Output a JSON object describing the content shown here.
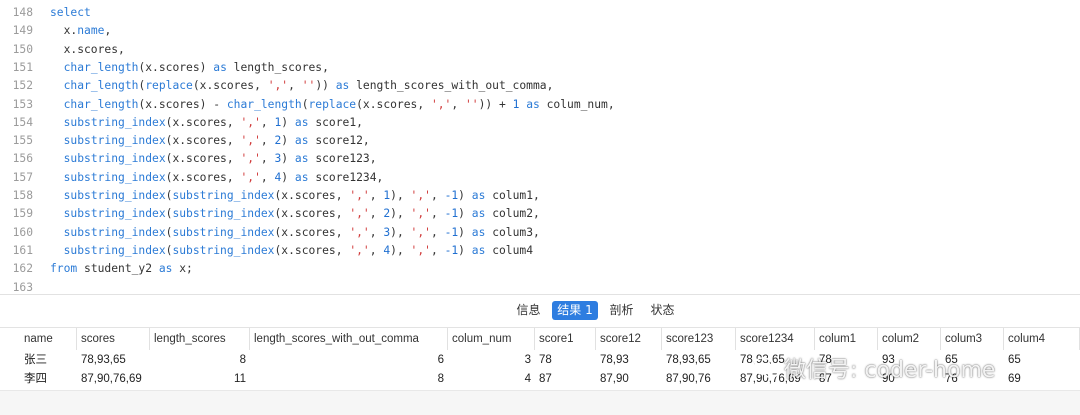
{
  "editor": {
    "lines": [
      {
        "num": "148",
        "tokens": [
          [
            "kw",
            "select"
          ]
        ]
      },
      {
        "num": "149",
        "tokens": [
          [
            "id",
            "  x."
          ],
          [
            "kw",
            "name"
          ],
          [
            "id",
            ","
          ]
        ]
      },
      {
        "num": "150",
        "tokens": [
          [
            "id",
            "  x.scores,"
          ]
        ]
      },
      {
        "num": "151",
        "tokens": [
          [
            "id",
            "  "
          ],
          [
            "fn",
            "char_length"
          ],
          [
            "id",
            "(x.scores) "
          ],
          [
            "kw",
            "as"
          ],
          [
            "id",
            " length_scores,"
          ]
        ]
      },
      {
        "num": "152",
        "tokens": [
          [
            "id",
            "  "
          ],
          [
            "fn",
            "char_length"
          ],
          [
            "id",
            "("
          ],
          [
            "fn",
            "replace"
          ],
          [
            "id",
            "(x.scores, "
          ],
          [
            "str",
            "','"
          ],
          [
            "id",
            ", "
          ],
          [
            "str",
            "''"
          ],
          [
            "id",
            ")) "
          ],
          [
            "kw",
            "as"
          ],
          [
            "id",
            " length_scores_with_out_comma,"
          ]
        ]
      },
      {
        "num": "153",
        "tokens": [
          [
            "id",
            "  "
          ],
          [
            "fn",
            "char_length"
          ],
          [
            "id",
            "(x.scores) - "
          ],
          [
            "fn",
            "char_length"
          ],
          [
            "id",
            "("
          ],
          [
            "fn",
            "replace"
          ],
          [
            "id",
            "(x.scores, "
          ],
          [
            "str",
            "','"
          ],
          [
            "id",
            ", "
          ],
          [
            "str",
            "''"
          ],
          [
            "id",
            ")) + "
          ],
          [
            "num",
            "1"
          ],
          [
            "id",
            " "
          ],
          [
            "kw",
            "as"
          ],
          [
            "id",
            " colum_num,"
          ]
        ]
      },
      {
        "num": "154",
        "tokens": [
          [
            "id",
            "  "
          ],
          [
            "fn",
            "substring_index"
          ],
          [
            "id",
            "(x.scores, "
          ],
          [
            "str",
            "','"
          ],
          [
            "id",
            ", "
          ],
          [
            "num",
            "1"
          ],
          [
            "id",
            ") "
          ],
          [
            "kw",
            "as"
          ],
          [
            "id",
            " score1,"
          ]
        ]
      },
      {
        "num": "155",
        "tokens": [
          [
            "id",
            "  "
          ],
          [
            "fn",
            "substring_index"
          ],
          [
            "id",
            "(x.scores, "
          ],
          [
            "str",
            "','"
          ],
          [
            "id",
            ", "
          ],
          [
            "num",
            "2"
          ],
          [
            "id",
            ") "
          ],
          [
            "kw",
            "as"
          ],
          [
            "id",
            " score12,"
          ]
        ]
      },
      {
        "num": "156",
        "tokens": [
          [
            "id",
            "  "
          ],
          [
            "fn",
            "substring_index"
          ],
          [
            "id",
            "(x.scores, "
          ],
          [
            "str",
            "','"
          ],
          [
            "id",
            ", "
          ],
          [
            "num",
            "3"
          ],
          [
            "id",
            ") "
          ],
          [
            "kw",
            "as"
          ],
          [
            "id",
            " score123,"
          ]
        ]
      },
      {
        "num": "157",
        "tokens": [
          [
            "id",
            "  "
          ],
          [
            "fn",
            "substring_index"
          ],
          [
            "id",
            "(x.scores, "
          ],
          [
            "str",
            "','"
          ],
          [
            "id",
            ", "
          ],
          [
            "num",
            "4"
          ],
          [
            "id",
            ") "
          ],
          [
            "kw",
            "as"
          ],
          [
            "id",
            " score1234,"
          ]
        ]
      },
      {
        "num": "158",
        "tokens": [
          [
            "id",
            "  "
          ],
          [
            "fn",
            "substring_index"
          ],
          [
            "id",
            "("
          ],
          [
            "fn",
            "substring_index"
          ],
          [
            "id",
            "(x.scores, "
          ],
          [
            "str",
            "','"
          ],
          [
            "id",
            ", "
          ],
          [
            "num",
            "1"
          ],
          [
            "id",
            "), "
          ],
          [
            "str",
            "','"
          ],
          [
            "id",
            ", "
          ],
          [
            "num",
            "-1"
          ],
          [
            "id",
            ") "
          ],
          [
            "kw",
            "as"
          ],
          [
            "id",
            " colum1,"
          ]
        ]
      },
      {
        "num": "159",
        "tokens": [
          [
            "id",
            "  "
          ],
          [
            "fn",
            "substring_index"
          ],
          [
            "id",
            "("
          ],
          [
            "fn",
            "substring_index"
          ],
          [
            "id",
            "(x.scores, "
          ],
          [
            "str",
            "','"
          ],
          [
            "id",
            ", "
          ],
          [
            "num",
            "2"
          ],
          [
            "id",
            "), "
          ],
          [
            "str",
            "','"
          ],
          [
            "id",
            ", "
          ],
          [
            "num",
            "-1"
          ],
          [
            "id",
            ") "
          ],
          [
            "kw",
            "as"
          ],
          [
            "id",
            " colum2,"
          ]
        ]
      },
      {
        "num": "160",
        "tokens": [
          [
            "id",
            "  "
          ],
          [
            "fn",
            "substring_index"
          ],
          [
            "id",
            "("
          ],
          [
            "fn",
            "substring_index"
          ],
          [
            "id",
            "(x.scores, "
          ],
          [
            "str",
            "','"
          ],
          [
            "id",
            ", "
          ],
          [
            "num",
            "3"
          ],
          [
            "id",
            "), "
          ],
          [
            "str",
            "','"
          ],
          [
            "id",
            ", "
          ],
          [
            "num",
            "-1"
          ],
          [
            "id",
            ") "
          ],
          [
            "kw",
            "as"
          ],
          [
            "id",
            " colum3,"
          ]
        ]
      },
      {
        "num": "161",
        "tokens": [
          [
            "id",
            "  "
          ],
          [
            "fn",
            "substring_index"
          ],
          [
            "id",
            "("
          ],
          [
            "fn",
            "substring_index"
          ],
          [
            "id",
            "(x.scores, "
          ],
          [
            "str",
            "','"
          ],
          [
            "id",
            ", "
          ],
          [
            "num",
            "4"
          ],
          [
            "id",
            "), "
          ],
          [
            "str",
            "','"
          ],
          [
            "id",
            ", "
          ],
          [
            "num",
            "-1"
          ],
          [
            "id",
            ") "
          ],
          [
            "kw",
            "as"
          ],
          [
            "id",
            " colum4"
          ]
        ]
      },
      {
        "num": "162",
        "tokens": [
          [
            "kw",
            "from"
          ],
          [
            "id",
            " student_y2 "
          ],
          [
            "kw",
            "as"
          ],
          [
            "id",
            " x;"
          ]
        ]
      },
      {
        "num": "163",
        "tokens": []
      }
    ]
  },
  "tabs": [
    {
      "label": "信息",
      "active": false
    },
    {
      "label": "结果 1",
      "active": true
    },
    {
      "label": "剖析",
      "active": false
    },
    {
      "label": "状态",
      "active": false
    }
  ],
  "grid": {
    "columns": [
      "name",
      "scores",
      "length_scores",
      "length_scores_with_out_comma",
      "colum_num",
      "score1",
      "score12",
      "score123",
      "score1234",
      "colum1",
      "colum2",
      "colum3",
      "colum4"
    ],
    "rows": [
      [
        "张三",
        "78,93,65",
        "8",
        "6",
        "3",
        "78",
        "78,93",
        "78,93,65",
        "78,93,65",
        "78",
        "93",
        "65",
        "65"
      ],
      [
        "李四",
        "87,90,76,69",
        "11",
        "8",
        "4",
        "87",
        "87,90",
        "87,90,76",
        "87,90,76,69",
        "87",
        "90",
        "76",
        "69"
      ]
    ]
  },
  "watermark": {
    "text": "微信号: coder-home"
  },
  "colors": {
    "keyword": "#2c7bd6",
    "string": "#d03a3a",
    "number": "#1f6fd1",
    "active_tab": "#2e7de0"
  }
}
